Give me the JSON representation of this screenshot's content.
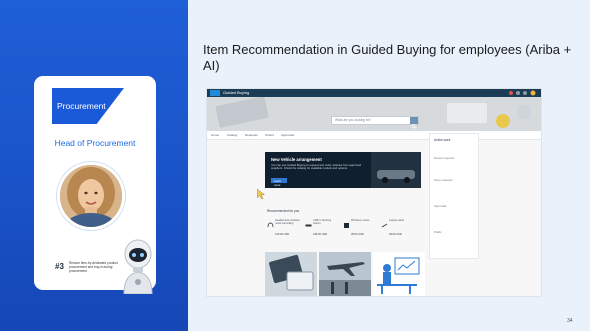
{
  "card": {
    "tag": "Procurement",
    "role": "Head of Procurement",
    "badge_number": "#3",
    "badge_text": "Reduce time-by-dedicated product procurement and buy-in during procurement"
  },
  "title": "Item Recommendation in Guided Buying for employees (Ariba + AI)",
  "screenshot": {
    "app_title": "Guided Buying",
    "search_placeholder": "What are you looking for?",
    "tabs": [
      "Home",
      "Catalog",
      "Requests",
      "Orders",
      "Approvals"
    ],
    "banner": {
      "title": "New Vehicle arrangement",
      "text": "You can use Guided Buying to request and order vehicles from approved suppliers. Check the catalog for available models and options.",
      "button": "Learn more"
    },
    "side_panel": {
      "heading": "Active work",
      "items": [
        "Recent requests",
        "Open requests",
        "Approvals",
        "Drafts"
      ]
    },
    "recommendations": {
      "heading": "Recommended for you",
      "items": [
        {
          "label": "Headphones wireless noise cancelling",
          "price": "120.00 USD"
        },
        {
          "label": "USB-C Docking station",
          "price": "245.00 USD"
        },
        {
          "label": "Wireless mouse",
          "price": "35.00 USD"
        },
        {
          "label": "Laptop stand",
          "price": "49.00 USD"
        }
      ]
    }
  },
  "page_number": "34",
  "colors": {
    "brand_blue": "#1a5ad8",
    "panel_blue": "#1f5fd6",
    "app_bar": "#1c3b55"
  }
}
